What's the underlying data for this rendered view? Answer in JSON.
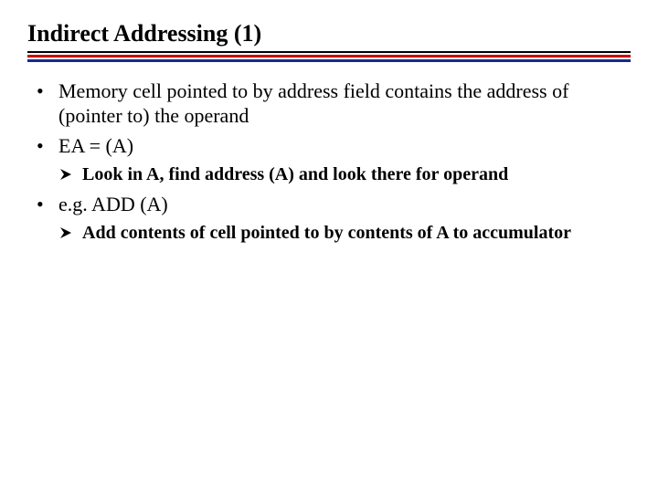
{
  "title": "Indirect Addressing (1)",
  "bullets": {
    "b1": "Memory cell pointed to by address field contains the address of (pointer to) the operand",
    "b2": "EA = (A)",
    "sub1": "Look in A, find address (A) and look there for operand",
    "b3": "e.g. ADD (A)",
    "sub2": "Add contents of cell pointed to by contents of A to accumulator"
  }
}
